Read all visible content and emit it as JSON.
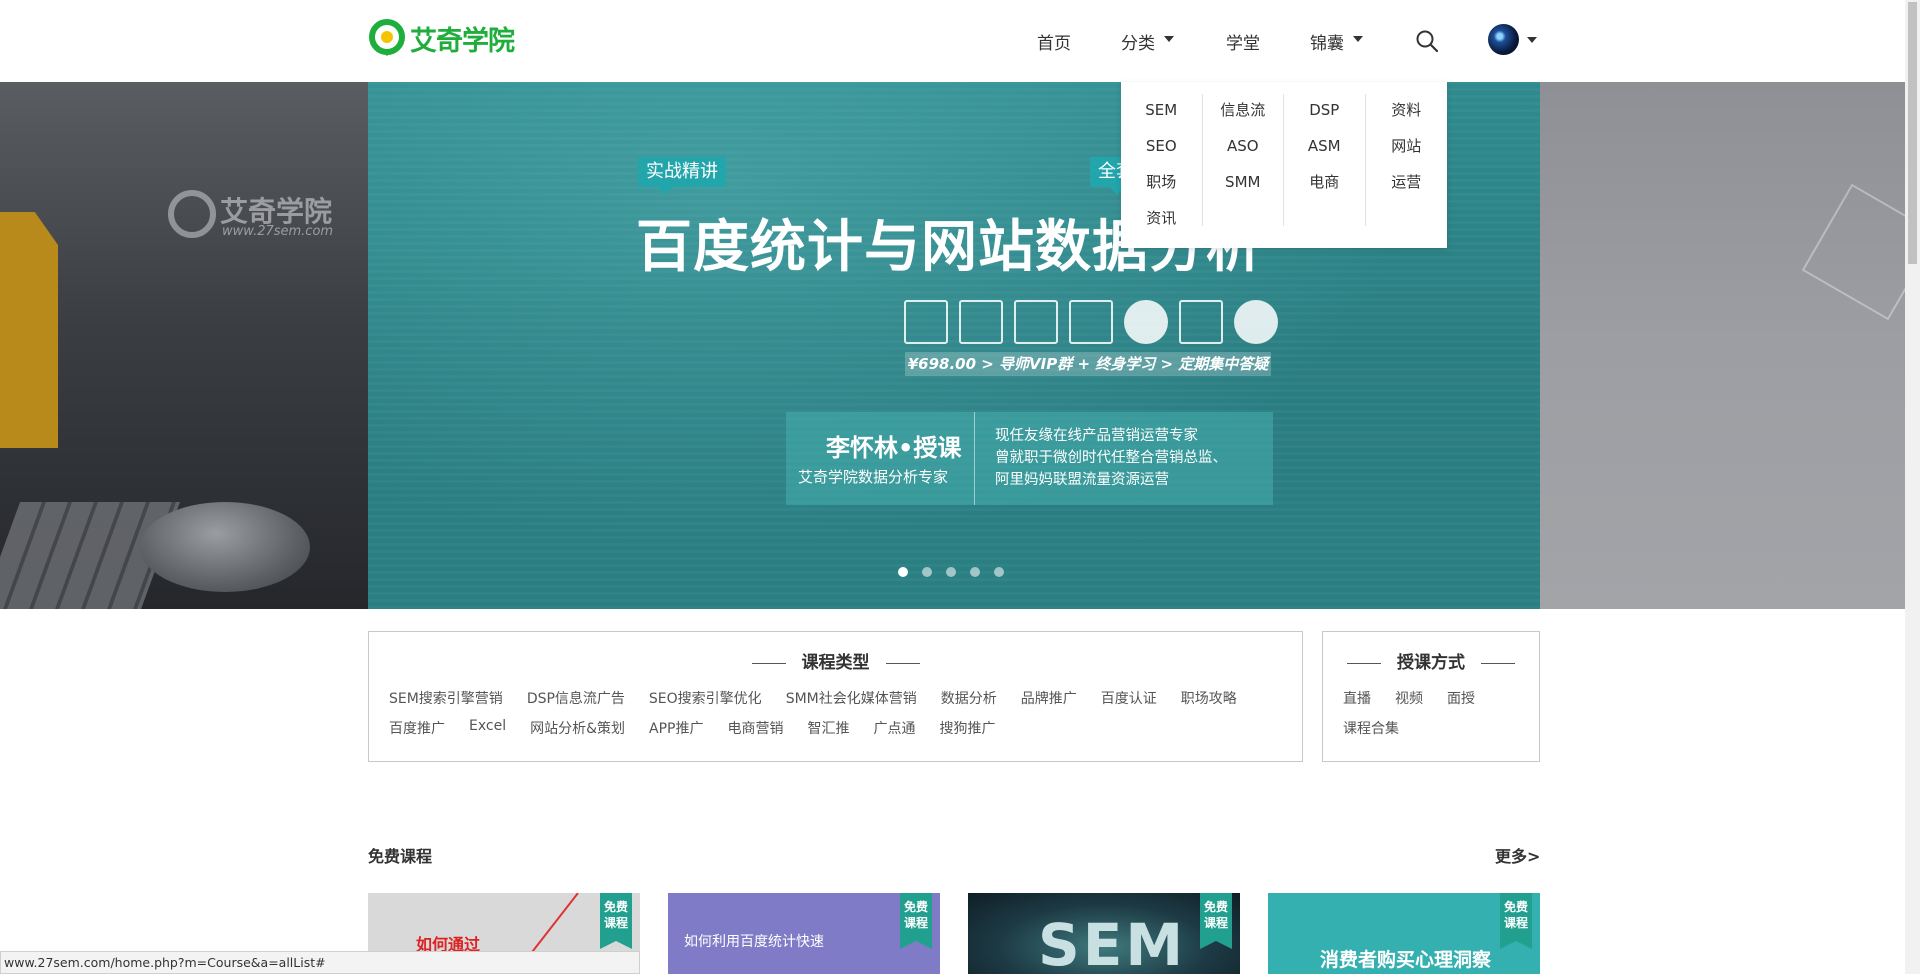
{
  "header": {
    "logo_text": "艾奇学院",
    "nav": [
      {
        "label": "首页",
        "has_caret": false
      },
      {
        "label": "分类",
        "has_caret": true
      },
      {
        "label": "学堂",
        "has_caret": false
      },
      {
        "label": "锦囊",
        "has_caret": true
      }
    ],
    "search_icon": "search-icon",
    "avatar_icon": "user-avatar"
  },
  "dropdown": {
    "columns": [
      [
        "SEM",
        "SEO",
        "职场",
        "资讯"
      ],
      [
        "信息流",
        "ASO",
        "SMM"
      ],
      [
        "DSP",
        "ASM",
        "电商"
      ],
      [
        "资料",
        "网站",
        "运营"
      ]
    ]
  },
  "banner": {
    "watermark_name": "艾奇学院",
    "watermark_url": "www.27sem.com",
    "tag_left": "实战精讲",
    "tag_right": "全套",
    "title": "百度统计与网站数据分析",
    "price_line": "¥698.00 > 导师VIP群 + 终身学习 > 定期集中答疑",
    "teacher_name": "李怀林•授课",
    "teacher_role": "艾奇学院数据分析专家",
    "teacher_desc": [
      "现任友缘在线产品营销运营专家",
      "曾就职于微创时代任整合营销总监、",
      "阿里妈妈联盟流量资源运营"
    ],
    "slides": 5,
    "active_slide": 1
  },
  "course_types": {
    "title": "课程类型",
    "row1": [
      "SEM搜索引擎营销",
      "DSP信息流广告",
      "SEO搜索引擎优化",
      "SMM社会化媒体营销",
      "数据分析",
      "品牌推广",
      "百度认证",
      "职场攻略"
    ],
    "row2": [
      "百度推广",
      "Excel",
      "网站分析&策划",
      "APP推广",
      "电商营销",
      "智汇推",
      "广点通",
      "搜狗推广"
    ]
  },
  "teaching_modes": {
    "title": "授课方式",
    "row1": [
      "直播",
      "视频",
      "面授"
    ],
    "row2": [
      "课程合集"
    ]
  },
  "free_courses": {
    "title": "免费课程",
    "more": "更多>",
    "ribbon": "免费课程",
    "cards": [
      {
        "text": "如何通过",
        "bg": "#d9d9d9"
      },
      {
        "text": "如何利用百度统计快速",
        "bg": "#7f7bc6"
      },
      {
        "text": "SEM",
        "bg": "#1d3a44"
      },
      {
        "text": "消费者购买心理洞察",
        "bg": "#35b0b0"
      }
    ]
  },
  "statusbar": {
    "url": "www.27sem.com/home.php?m=Course&a=allList#"
  },
  "colors": {
    "brand_green": "#1fae3c",
    "banner_teal": "#2a7f83",
    "ribbon_teal": "#22a08f"
  }
}
